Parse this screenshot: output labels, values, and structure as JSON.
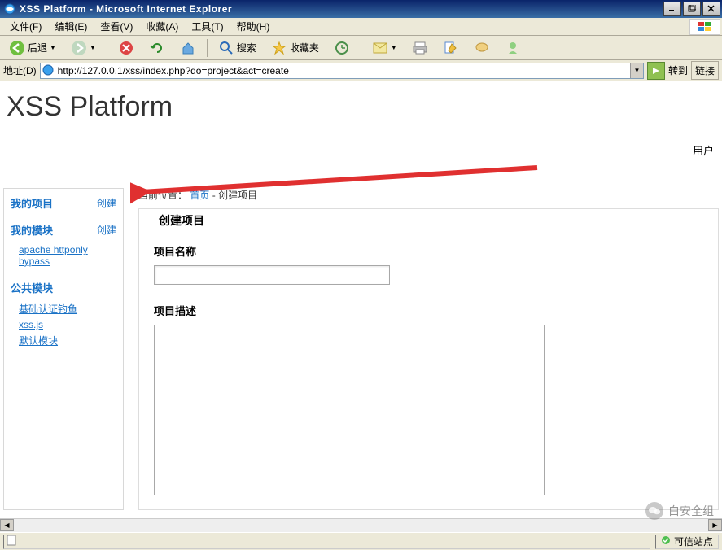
{
  "window": {
    "title": "XSS Platform - Microsoft Internet Explorer"
  },
  "menu": {
    "file": "文件(F)",
    "edit": "编辑(E)",
    "view": "查看(V)",
    "favorites": "收藏(A)",
    "tools": "工具(T)",
    "help": "帮助(H)"
  },
  "toolbar": {
    "back": "后退",
    "search": "搜索",
    "favorites": "收藏夹"
  },
  "addressbar": {
    "label": "地址(D)",
    "url": "http://127.0.0.1/xss/index.php?do=project&act=create",
    "go": "转到",
    "links": "链接"
  },
  "page": {
    "heading": "XSS Platform",
    "userlabel": "用户"
  },
  "sidebar": {
    "sections": [
      {
        "title": "我的项目",
        "action": "创建",
        "links": []
      },
      {
        "title": "我的模块",
        "action": "创建",
        "links": [
          "apache httponly bypass"
        ]
      },
      {
        "title": "公共模块",
        "action": "",
        "links": [
          "基础认证钓鱼",
          "xss.js",
          "默认模块"
        ]
      }
    ]
  },
  "breadcrumb": {
    "prefix": "当前位置：",
    "home": "首页",
    "sep": " - ",
    "current": "创建项目"
  },
  "form": {
    "legend": "创建项目",
    "name_label": "项目名称",
    "name_value": "",
    "desc_label": "项目描述",
    "desc_value": ""
  },
  "statusbar": {
    "trusted": "可信站点"
  },
  "watermark": {
    "text": "白安全组"
  }
}
